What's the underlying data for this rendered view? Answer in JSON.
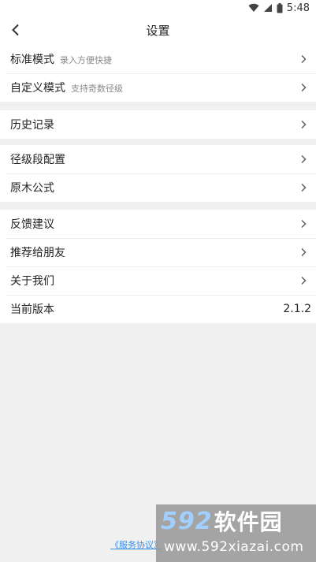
{
  "status_bar": {
    "time": "5:48",
    "icons": [
      "wifi-icon",
      "cell-signal-icon",
      "battery-icon"
    ]
  },
  "header": {
    "title": "设置",
    "back_icon": "chevron-left-icon"
  },
  "groups": [
    {
      "items": [
        {
          "title": "标准模式",
          "subtitle": "录入方便快捷"
        },
        {
          "title": "自定义模式",
          "subtitle": "支持奇数径级"
        }
      ]
    },
    {
      "items": [
        {
          "title": "历史记录"
        }
      ]
    },
    {
      "items": [
        {
          "title": "径级段配置"
        },
        {
          "title": "原木公式"
        }
      ]
    },
    {
      "items": [
        {
          "title": "反馈建议"
        },
        {
          "title": "推荐给朋友"
        },
        {
          "title": "关于我们"
        },
        {
          "title": "当前版本",
          "value": "2.1.2"
        }
      ]
    }
  ],
  "footer": {
    "link_text": "《服务协议》"
  },
  "watermark": {
    "number": "592",
    "name": "软件园",
    "url": "www.592xiazai.com"
  },
  "colors": {
    "background": "#f0f0f0",
    "link": "#3a8fe6"
  }
}
